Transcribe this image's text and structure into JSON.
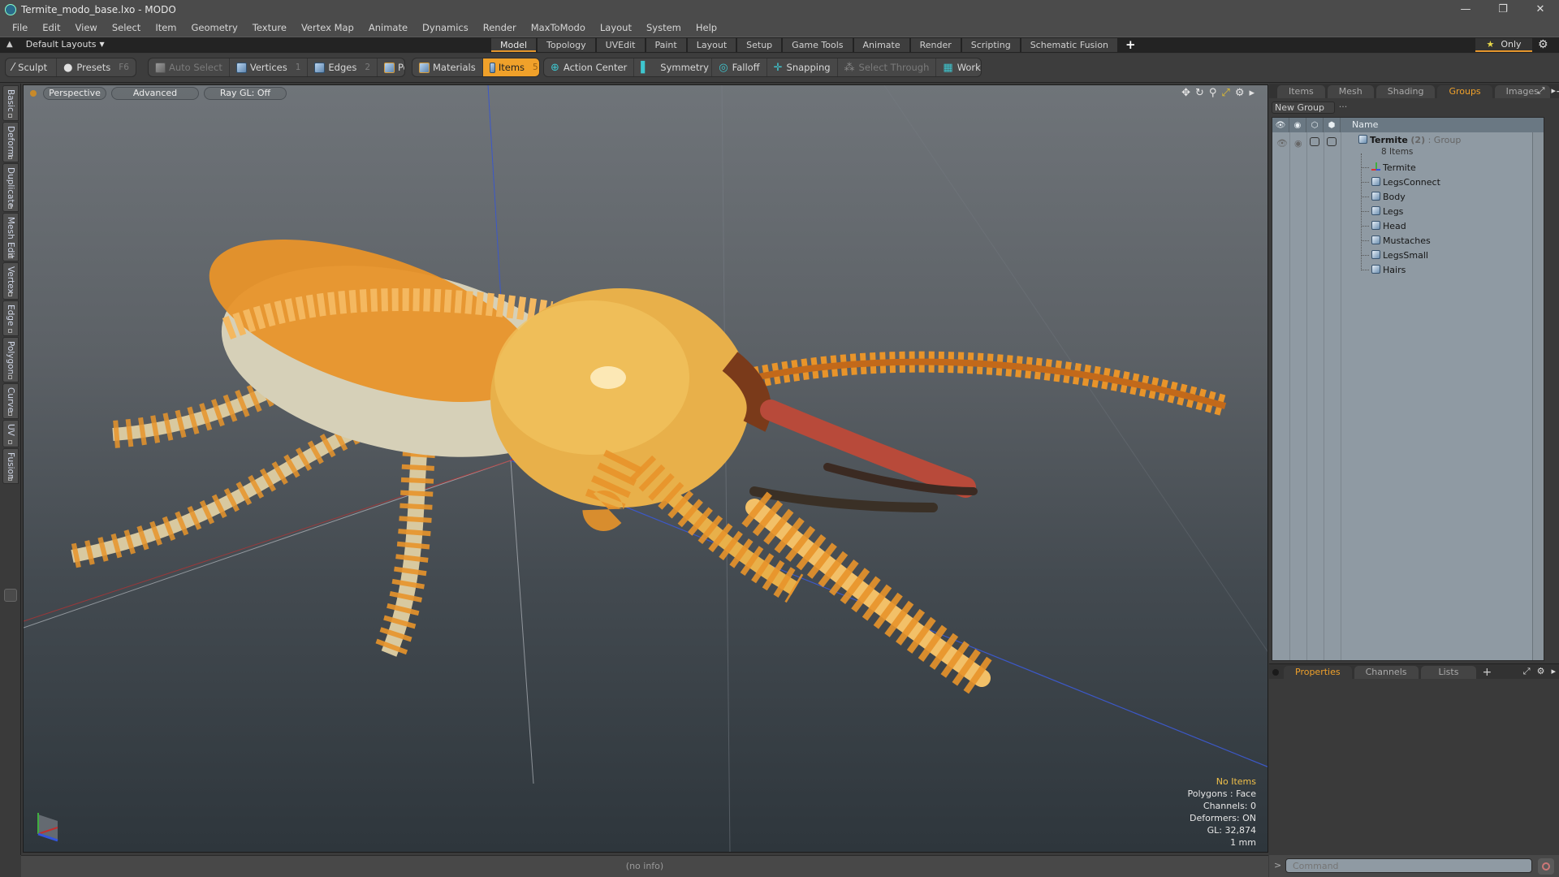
{
  "window": {
    "title": "Termite_modo_base.lxo - MODO",
    "controls": [
      "minimize",
      "restore",
      "close"
    ]
  },
  "menubar": {
    "items": [
      "File",
      "Edit",
      "View",
      "Select",
      "Item",
      "Geometry",
      "Texture",
      "Vertex Map",
      "Animate",
      "Dynamics",
      "Render",
      "MaxToModo",
      "Layout",
      "System",
      "Help"
    ]
  },
  "layoutbar": {
    "layouts_label": "Default Layouts",
    "tabs": [
      "Model",
      "Topology",
      "UVEdit",
      "Paint",
      "Layout",
      "Setup",
      "Game Tools",
      "Animate",
      "Render",
      "Scripting",
      "Schematic Fusion"
    ],
    "active_tab": "Model",
    "add_label": "+",
    "only_label": "Only"
  },
  "toolbar": {
    "sculpt": "Sculpt",
    "presets": "Presets",
    "presets_key": "F6",
    "auto_select": "Auto Select",
    "vertices": "Vertices",
    "vertices_key": "1",
    "edges": "Edges",
    "edges_key": "2",
    "polygons": "Polygons",
    "materials": "Materials",
    "items": "Items",
    "items_key": "5",
    "action_center": "Action Center",
    "symmetry": "Symmetry",
    "falloff": "Falloff",
    "snapping": "Snapping",
    "select_through": "Select Through",
    "workplane": "WorkPlane"
  },
  "left_tabs": [
    "Basic",
    "Deform",
    "Duplicate",
    "Mesh Edit",
    "Vertex",
    "Edge",
    "Polygon",
    "Curve",
    "UV",
    "Fusion"
  ],
  "viewport": {
    "view_mode": "Perspective",
    "shading": "Advanced",
    "raygl": "Ray GL: Off",
    "info": {
      "selection": "No Items",
      "polygons": "Polygons : Face",
      "channels": "Channels: 0",
      "deformers": "Deformers: ON",
      "gl": "GL: 32,874",
      "scale": "1 mm"
    },
    "model_name": "Termite",
    "colors": {
      "hair_orange": "#e8942a",
      "body_yellow": "#e8b04a",
      "mandible_red": "#b84a3a",
      "leg_cream": "#d8c9a0"
    }
  },
  "groups_panel": {
    "tabs": [
      "Items",
      "Mesh ...",
      "Shading",
      "Groups",
      "Images"
    ],
    "active_tab": "Groups",
    "new_group_label": "New Group",
    "column_name": "Name",
    "group": {
      "name": "Termite",
      "count": "(2)",
      "type": ": Group",
      "items_count": "8 Items"
    },
    "children": [
      {
        "name": "Termite",
        "icon": "locator-icon"
      },
      {
        "name": "LegsConnect",
        "icon": "mesh-icon"
      },
      {
        "name": "Body",
        "icon": "mesh-icon"
      },
      {
        "name": "Legs",
        "icon": "mesh-icon"
      },
      {
        "name": "Head",
        "icon": "mesh-icon"
      },
      {
        "name": "Mustaches",
        "icon": "mesh-icon"
      },
      {
        "name": "LegsSmall",
        "icon": "mesh-icon"
      },
      {
        "name": "Hairs",
        "icon": "mesh-icon"
      }
    ]
  },
  "properties_panel": {
    "tabs": [
      "Properties",
      "Channels",
      "Lists"
    ],
    "active_tab": "Properties"
  },
  "statusbar": {
    "info": "(no info)",
    "command_placeholder": "Command"
  },
  "accent": "#f0a12a"
}
